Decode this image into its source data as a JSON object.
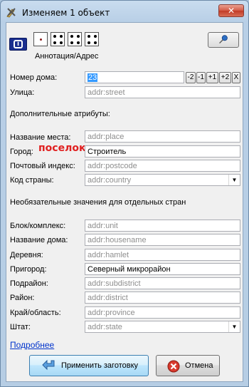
{
  "window": {
    "title": "Изменяем 1 объект",
    "close_glyph": "✕",
    "icon": "josm-edit-icon"
  },
  "toolbar": {
    "preset_caption": "Аннотация/Адрес",
    "info_icon_glyph": "i",
    "pin_icon": "pushpin-icon"
  },
  "fields": {
    "housenumber": {
      "label": "Номер дома:",
      "value": "23"
    },
    "street": {
      "label": "Улица:",
      "placeholder": "addr:street"
    },
    "extra_header": "Дополнительные атрибуты:",
    "place": {
      "label": "Название места:",
      "placeholder": "addr:place"
    },
    "city": {
      "label": "Город:",
      "value": "Строитель",
      "annotation": "поселок"
    },
    "postcode": {
      "label": "Почтовый индекс:",
      "placeholder": "addr:postcode"
    },
    "country": {
      "label": "Код страны:",
      "placeholder": "addr:country"
    },
    "optional_header": "Необязательные значения для отдельных стран",
    "unit": {
      "label": "Блок/комплекс:",
      "placeholder": "addr:unit"
    },
    "housename": {
      "label": "Название дома:",
      "placeholder": "addr:housename"
    },
    "hamlet": {
      "label": "Деревня:",
      "placeholder": "addr:hamlet"
    },
    "suburb": {
      "label": "Пригород:",
      "value": "Северный микрорайон"
    },
    "subdistrict": {
      "label": "Подрайон:",
      "placeholder": "addr:subdistrict"
    },
    "district": {
      "label": "Район:",
      "placeholder": "addr:district"
    },
    "province": {
      "label": "Край/область:",
      "placeholder": "addr:province"
    },
    "state": {
      "label": "Штат:",
      "placeholder": "addr:state"
    }
  },
  "stepper": {
    "minus2": "-2",
    "minus1": "-1",
    "plus1": "+1",
    "plus2": "+2",
    "clear": "X"
  },
  "more_link": "Подробнее",
  "buttons": {
    "apply": "Применить заготовку",
    "cancel": "Отмена"
  },
  "colors": {
    "annotation_red": "#e02020",
    "link_blue": "#0033cc",
    "selection_blue": "#3399ff"
  }
}
